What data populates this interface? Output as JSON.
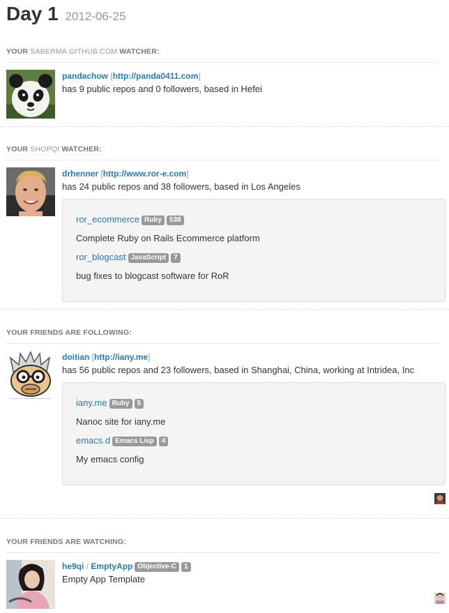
{
  "header": {
    "title": "Day 1",
    "date": "2012-06-25"
  },
  "sections": [
    {
      "head_pre": "YOUR",
      "head_repo": "SABERMA.GITHUB.COM",
      "head_post": "WATCHER:",
      "user": "pandachow",
      "url": "http://panda0411.com",
      "bio": "has 9 public repos and 0 followers, based in Hefei"
    },
    {
      "head_pre": "YOUR",
      "head_repo": "SHOPQI",
      "head_post": "WATCHER:",
      "user": "drhenner",
      "url": "http://www.ror-e.com",
      "bio": "has 24 public repos and 38 followers, based in Los Angeles",
      "repos": [
        {
          "name": "ror_ecommerce",
          "lang": "Ruby",
          "count": "538",
          "desc": "Complete Ruby on Rails Ecommerce platform"
        },
        {
          "name": "ror_blogcast",
          "lang": "JavaScript",
          "count": "7",
          "desc": "bug fixes to blogcast software for RoR"
        }
      ]
    },
    {
      "head": "YOUR FRIENDS ARE FOLLOWING:",
      "user": "doitian",
      "url": "http://iany.me",
      "bio": "has 56 public repos and 23 followers, based in Shanghai, China, working at Intridea, Inc",
      "repos": [
        {
          "name": "iany.me",
          "lang": "Ruby",
          "count": "5",
          "desc": "Nanoc site for iany.me"
        },
        {
          "name": "emacs.d",
          "lang": "Emacs Lisp",
          "count": "4",
          "desc": "My emacs config"
        }
      ]
    },
    {
      "head": "YOUR FRIENDS ARE WATCHING:",
      "owner": "he9qi",
      "sep": "/",
      "repo": "EmptyApp",
      "lang": "Objective-C",
      "count": "1",
      "desc": "Empty App Template"
    }
  ],
  "brackets": {
    "open": "[",
    "close": "]"
  }
}
